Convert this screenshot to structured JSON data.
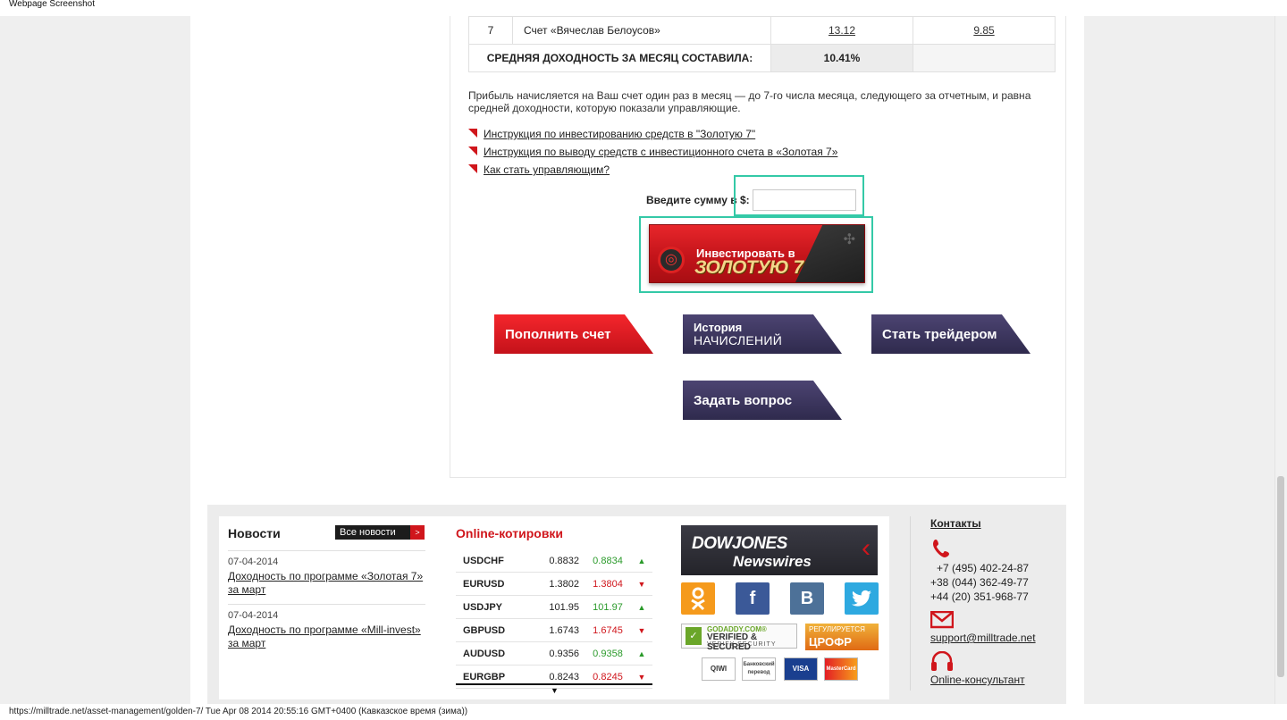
{
  "window": {
    "title": "Webpage Screenshot"
  },
  "results_table": {
    "row": {
      "num": "7",
      "name": "Счет «Вячеслав Белоусов»",
      "v1": "13.12",
      "v2": "9.85"
    },
    "avg_label": "СРЕДНЯЯ ДОХОДНОСТЬ ЗА МЕСЯЦ СОСТАВИЛА:",
    "avg_value": "10.41%"
  },
  "profit_text": "Прибыль начисляется на Ваш счет один раз в месяц — до 7-го числа месяца, следующего за отчетным, и равна средней доходности, которую показали управляющие.",
  "links": [
    "Инструкция по инвестированию средств в \"Золотую 7\"",
    "Инструкция по выводу средств с инвестиционного счета в «Золотая 7»",
    "Как стать управляющим?"
  ],
  "amount": {
    "label": "Введите сумму в $:",
    "value": ""
  },
  "invest_button": {
    "line1": "Инвестировать в",
    "line2": "ЗОЛОТУЮ 7"
  },
  "actions": {
    "deposit": "Пополнить счет",
    "history_top": "История",
    "history_bottom": "НАЧИСЛЕНИЙ",
    "become_trader": "Стать трейдером",
    "ask_question": "Задать вопрос"
  },
  "news": {
    "title": "Новости",
    "all_label": "Все новости",
    "items": [
      {
        "date": "07-04-2014",
        "title": "Доходность по программе «Золотая 7» за март"
      },
      {
        "date": "07-04-2014",
        "title": "Доходность по программе «Mill-invest» за март"
      }
    ]
  },
  "quotes": {
    "title": "Online-котировки",
    "rows": [
      {
        "symbol": "USDCHF",
        "bid": "0.8832",
        "ask": "0.8834",
        "dir": "▲"
      },
      {
        "symbol": "EURUSD",
        "bid": "1.3802",
        "ask": "1.3804",
        "dir": "▼"
      },
      {
        "symbol": "USDJPY",
        "bid": "101.95",
        "ask": "101.97",
        "dir": "▲"
      },
      {
        "symbol": "GBPUSD",
        "bid": "1.6743",
        "ask": "1.6745",
        "dir": "▼"
      },
      {
        "symbol": "AUDUSD",
        "bid": "0.9356",
        "ask": "0.9358",
        "dir": "▲"
      },
      {
        "symbol": "EURGBP",
        "bid": "0.8243",
        "ask": "0.8245",
        "dir": "▼"
      }
    ],
    "more": "▼"
  },
  "dowjones": {
    "line1": "DOWJONES",
    "line2": "Newswires"
  },
  "social": {
    "ok": "ok-icon",
    "facebook": "f",
    "vk": "B",
    "twitter": "twitter-icon"
  },
  "badges": {
    "godaddy_top": "GODADDY.COM®",
    "godaddy_mid": "VERIFIED & SECURED",
    "godaddy_bot": "VERIFY SECURITY",
    "crofr_top": "РЕГУЛИРУЕТСЯ",
    "crofr_main": "ЦРОФР"
  },
  "payments": [
    "QIWI",
    "Банковский перевод",
    "VISA",
    "MasterCard"
  ],
  "contacts": {
    "title": "Контакты",
    "phones": [
      "+7 (495) 402-24-87",
      "+38 (044) 362-49-77",
      "+44 (20) 351-968-77"
    ],
    "email": "support@milltrade.net",
    "consultant": "Online-консультант"
  },
  "statusbar": "https://milltrade.net/asset-management/golden-7/ Tue Apr 08 2014 20:55:16 GMT+0400 (Кавказское время (зима))",
  "colors": {
    "accent_red": "#d0161c",
    "purple": "#3d365e",
    "highlight": "#34c9a7",
    "up": "#2a9a2a"
  }
}
